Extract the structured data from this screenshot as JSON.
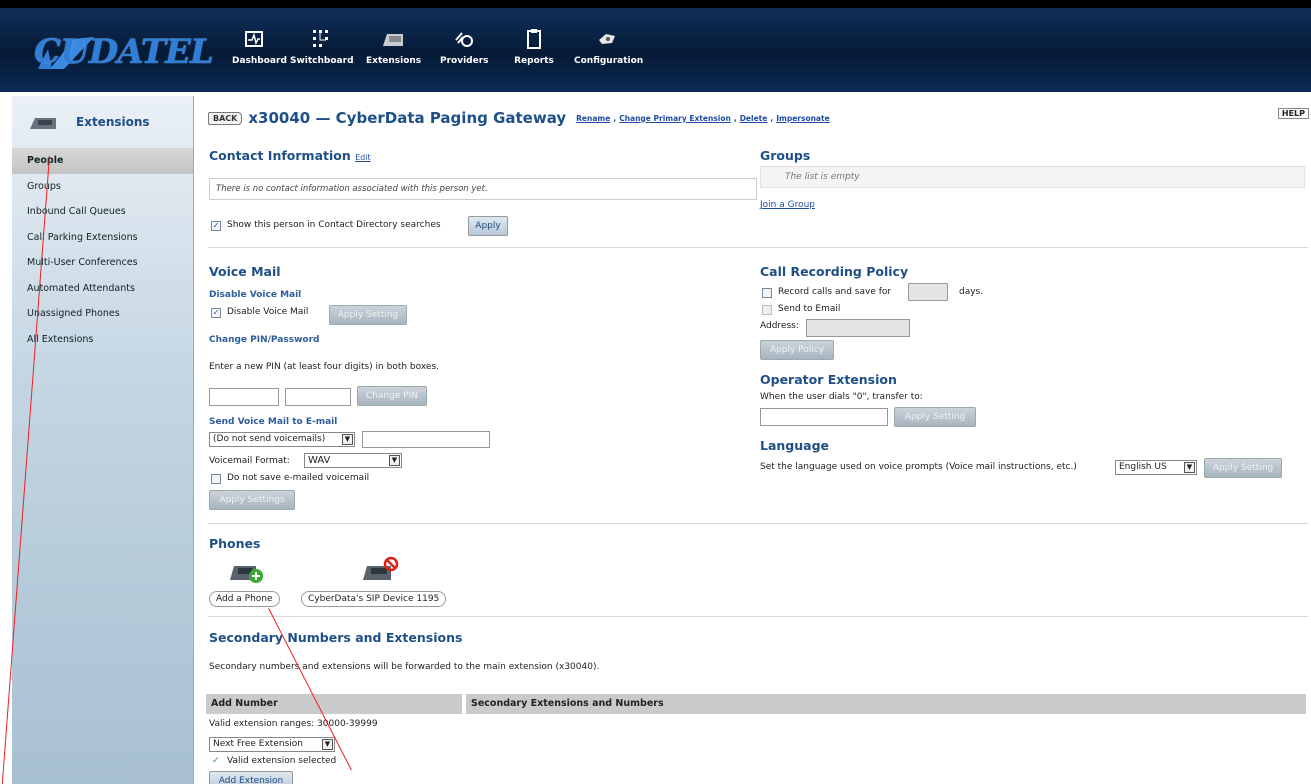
{
  "nav": {
    "logo_text": "CUDATEL",
    "items": [
      {
        "label": "Dashboard",
        "icon": "dashboard-icon"
      },
      {
        "label": "Switchboard",
        "icon": "switchboard-icon"
      },
      {
        "label": "Extensions",
        "icon": "extensions-icon"
      },
      {
        "label": "Providers",
        "icon": "providers-icon"
      },
      {
        "label": "Reports",
        "icon": "reports-icon"
      },
      {
        "label": "Configuration",
        "icon": "configuration-icon"
      }
    ]
  },
  "sidebar": {
    "title": "Extensions",
    "items": [
      "People",
      "Groups",
      "Inbound Call Queues",
      "Call Parking Extensions",
      "Multi-User Conferences",
      "Automated Attendants",
      "Unassigned Phones",
      "All Extensions"
    ]
  },
  "header": {
    "back": "BACK",
    "title": "x30040 — CyberData Paging Gateway",
    "links": [
      "Rename",
      "Change Primary Extension",
      "Delete",
      "Impersonate"
    ],
    "help": "HELP"
  },
  "contact": {
    "heading": "Contact Information",
    "edit": "Edit",
    "empty_msg": "There is no contact information associated with this person yet.",
    "directory_label": "Show this person in Contact Directory searches",
    "directory_checked": true,
    "apply": "Apply"
  },
  "groups": {
    "heading": "Groups",
    "empty": "The list is empty",
    "join": "Join a Group"
  },
  "voicemail": {
    "heading": "Voice Mail",
    "disable_sub": "Disable Voice Mail",
    "disable_label": "Disable Voice Mail",
    "disable_checked": true,
    "apply_setting": "Apply Setting",
    "pin_sub": "Change PIN/Password",
    "pin_help": "Enter a new PIN (at least four digits) in both boxes.",
    "change_pin": "Change PIN",
    "send_sub": "Send Voice Mail to E-mail",
    "send_option": "(Do not send voicemails)",
    "format_label": "Voicemail Format:",
    "format_value": "WAV",
    "no_save_label": "Do not save e-mailed voicemail",
    "apply_settings": "Apply Settings"
  },
  "recording": {
    "heading": "Call Recording Policy",
    "record_label": "Record calls and save for",
    "days": "days.",
    "send_email": "Send to Email",
    "address": "Address:",
    "apply_policy": "Apply Policy"
  },
  "operator": {
    "heading": "Operator Extension",
    "help": "When the user dials \"0\", transfer to:",
    "apply_setting": "Apply Setting"
  },
  "language": {
    "heading": "Language",
    "help": "Set the language used on voice prompts (Voice mail instructions, etc.)",
    "value": "English  US",
    "apply_setting": "Apply Setting"
  },
  "phones": {
    "heading": "Phones",
    "add": "Add a Phone",
    "device": "CyberData's SIP Device 1195"
  },
  "secondary": {
    "heading": "Secondary Numbers and Extensions",
    "help": "Secondary numbers and extensions will be forwarded to the main extension (x30040).",
    "col1": "Add Number",
    "col2": "Secondary Extensions and Numbers",
    "ranges": "Valid extension ranges: 30000-39999",
    "select": "Next Free Extension",
    "valid": "Valid extension selected",
    "add_ext": "Add Extension"
  }
}
